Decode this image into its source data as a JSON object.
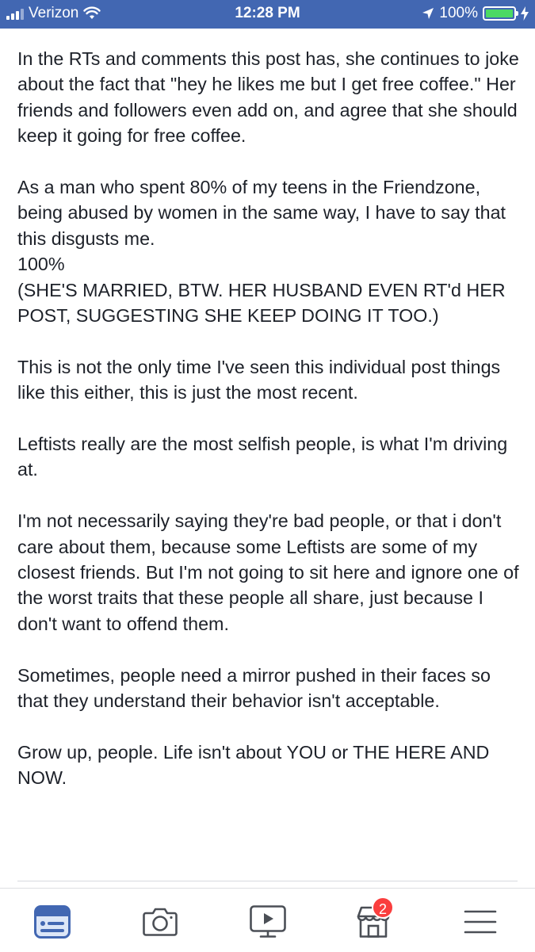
{
  "status_bar": {
    "carrier": "Verizon",
    "time": "12:28 PM",
    "battery_percent": "100%",
    "battery_level": 1.0,
    "battery_color": "#4cd964",
    "background_color": "#4267b2"
  },
  "post": {
    "paragraphs": [
      "In the RTs and comments this post has, she continues to joke about the fact that \"hey he likes me but I get free coffee.\" Her friends and followers even add on, and agree that she should keep it going for free coffee.",
      "As a man who spent 80% of my teens in the Friendzone, being abused by women in the same way, I have to say that this disgusts me.\n100%\n(SHE'S MARRIED, BTW. HER HUSBAND EVEN RT'd HER POST, SUGGESTING SHE KEEP DOING IT TOO.)",
      "This is not the only time I've seen this individual post things like this either, this is just the most recent.",
      "Leftists really are the most selfish people, is what I'm driving at.",
      "I'm not necessarily saying they're bad people, or that i don't care about them, because some Leftists are some of my closest friends. But I'm not going to sit here and ignore one of the worst traits that these people all share, just because I don't want to offend them.",
      "Sometimes, people need a mirror pushed in their faces so that they understand their behavior isn't acceptable.",
      "Grow up, people. Life isn't about YOU or THE HERE AND NOW."
    ]
  },
  "tab_bar": {
    "tabs": [
      {
        "icon": "news-feed-icon",
        "active": true
      },
      {
        "icon": "camera-icon",
        "active": false
      },
      {
        "icon": "video-icon",
        "active": false
      },
      {
        "icon": "marketplace-icon",
        "active": false,
        "badge": "2"
      },
      {
        "icon": "menu-icon",
        "active": false
      }
    ],
    "active_color": "#4267b2",
    "inactive_color": "#4b4f56",
    "badge_color": "#fa3e3e"
  }
}
